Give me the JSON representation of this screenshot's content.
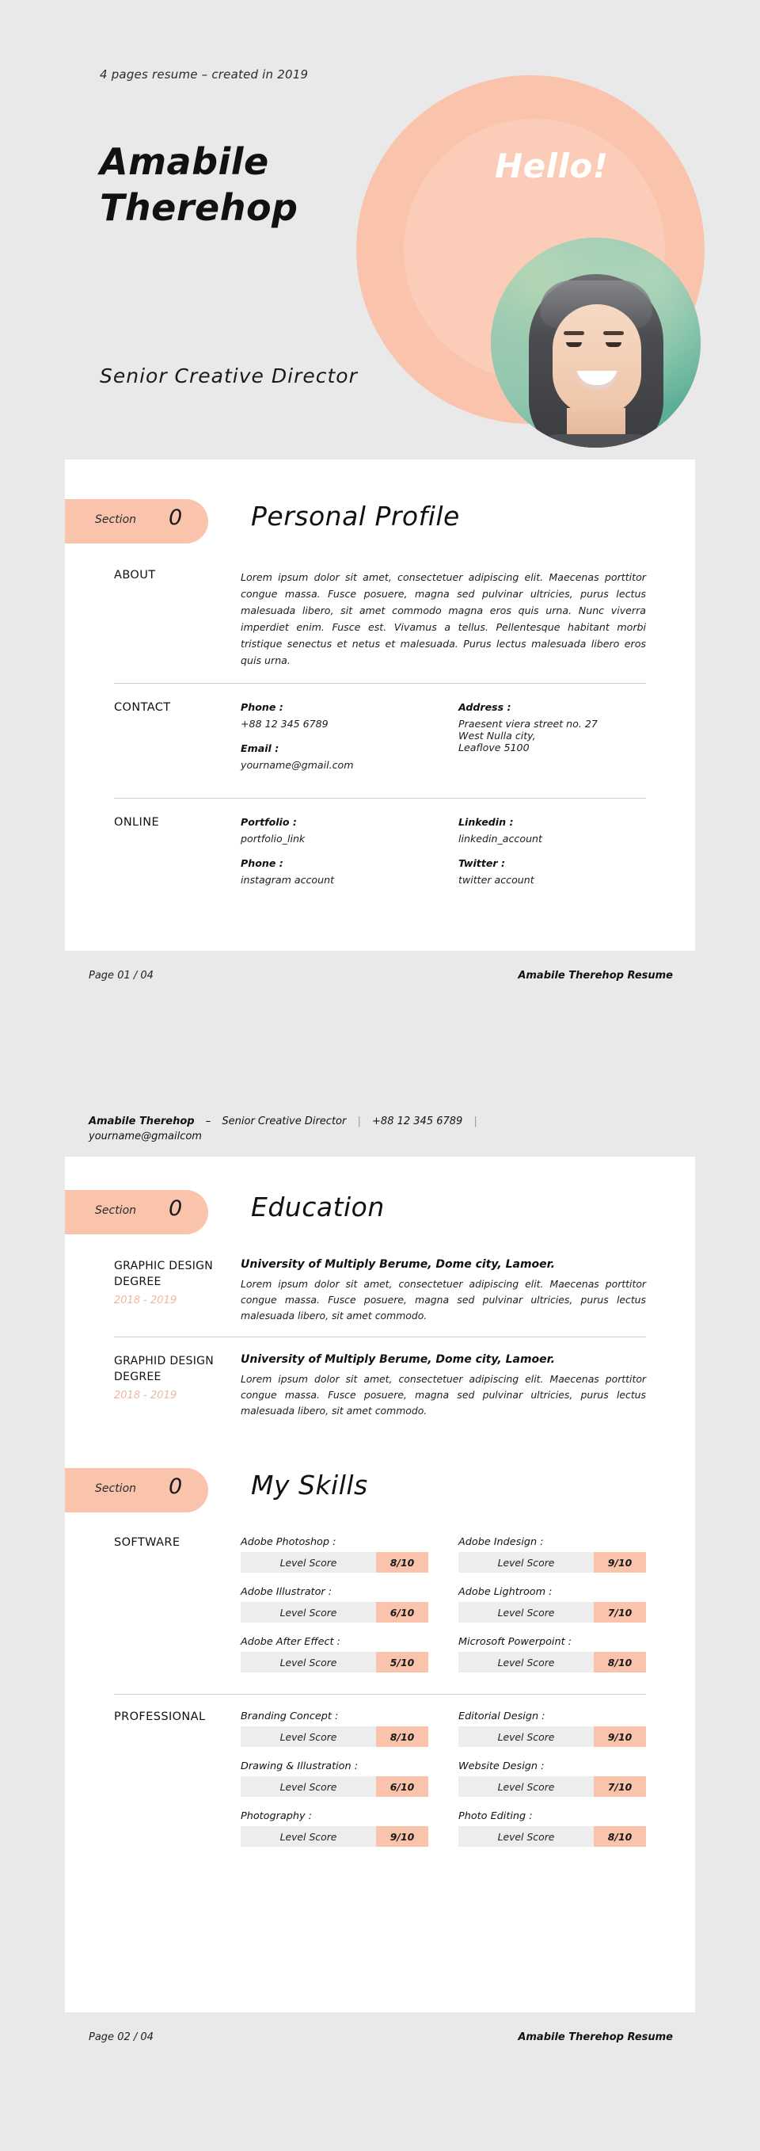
{
  "header": {
    "tagline": "4 pages resume – created in 2019",
    "name_line1": "Amabile",
    "name_line2": "Therehop",
    "hello": "Hello!",
    "job_title": "Senior Creative Director",
    "accent_color": "#f9c3ac",
    "background_color": "#e9e9e9"
  },
  "page1": {
    "section": {
      "label": "Section",
      "number": "0",
      "title": "Personal Profile"
    },
    "about": {
      "key": "ABOUT",
      "text": "Lorem ipsum dolor sit amet, consectetuer adipiscing elit. Maecenas porttitor congue massa. Fusce posuere, magna sed pulvinar ultricies, purus lectus malesuada libero, sit amet commodo magna eros quis urna. Nunc viverra imperdiet enim. Fusce est. Vivamus a tellus. Pellentesque habitant morbi tristique senectus et netus et malesuada. Purus lectus malesuada libero eros quis urna."
    },
    "contact": {
      "key": "CONTACT",
      "fields": [
        {
          "label": "Phone :",
          "value": "+88 12 345 6789"
        },
        {
          "label": "Email :",
          "value": "yourname@gmail.com"
        },
        {
          "label": "Address :",
          "value": "Praesent viera street no. 27"
        },
        {
          "label": "",
          "value": "West Nulla city,"
        },
        {
          "label": "",
          "value": "Leaflove 5100"
        }
      ]
    },
    "online": {
      "key": "ONLINE",
      "fields": [
        {
          "label": "Portfolio :",
          "value": "portfolio_link"
        },
        {
          "label": "Phone :",
          "value": "instagram account"
        },
        {
          "label": "Linkedin :",
          "value": "linkedin_account"
        },
        {
          "label": "Twitter :",
          "value": "twitter account"
        }
      ]
    },
    "footer": {
      "left": "Page 01 / 04",
      "right": "Amabile Therehop Resume"
    }
  },
  "page2": {
    "topbar": {
      "name": "Amabile Therehop",
      "dash": "–",
      "role": "Senior Creative Director",
      "phone": "+88 12 345 6789",
      "email": "yourname@gmailcom"
    },
    "education": {
      "section": {
        "label": "Section",
        "number": "0",
        "title": "Education"
      },
      "entries": [
        {
          "degree_line1": "GRAPHIC DESIGN",
          "degree_line2": "DEGREE",
          "years": "2018 - 2019",
          "university": "University of Multiply Berume, Dome city, Lamoer.",
          "description": "Lorem ipsum dolor sit amet, consectetuer adipiscing elit. Maecenas porttitor congue massa. Fusce posuere, magna sed pulvinar ultricies, purus lectus malesuada libero, sit amet commodo."
        },
        {
          "degree_line1": "GRAPHID DESIGN",
          "degree_line2": "DEGREE",
          "years": "2018  - 2019",
          "university": "University of Multiply Berume, Dome city, Lamoer.",
          "description": "Lorem ipsum dolor sit amet, consectetuer adipiscing elit. Maecenas porttitor congue massa. Fusce posuere, magna sed pulvinar ultricies, purus lectus malesuada libero, sit amet commodo."
        }
      ]
    },
    "skills": {
      "section": {
        "label": "Section",
        "number": "0",
        "title": "My Skills"
      },
      "level_label": "Level Score",
      "groups": [
        {
          "key": "SOFTWARE",
          "left": [
            {
              "name": "Adobe Photoshop :",
              "score": "8/10"
            },
            {
              "name": "Adobe Illustrator :",
              "score": "6/10"
            },
            {
              "name": "Adobe After Effect :",
              "score": "5/10"
            }
          ],
          "right": [
            {
              "name": "Adobe Indesign :",
              "score": "9/10"
            },
            {
              "name": "Adobe Lightroom :",
              "score": "7/10"
            },
            {
              "name": "Microsoft Powerpoint :",
              "score": "8/10"
            }
          ]
        },
        {
          "key": "PROFESSIONAL",
          "left": [
            {
              "name": "Branding Concept :",
              "score": "8/10"
            },
            {
              "name": "Drawing & Illustration :",
              "score": "6/10"
            },
            {
              "name": "Photography :",
              "score": "9/10"
            }
          ],
          "right": [
            {
              "name": "Editorial Design :",
              "score": "9/10"
            },
            {
              "name": "Website Design :",
              "score": "7/10"
            },
            {
              "name": "Photo Editing :",
              "score": "8/10"
            }
          ]
        }
      ]
    },
    "footer": {
      "left": "Page 02 / 04",
      "right": "Amabile Therehop Resume"
    }
  }
}
